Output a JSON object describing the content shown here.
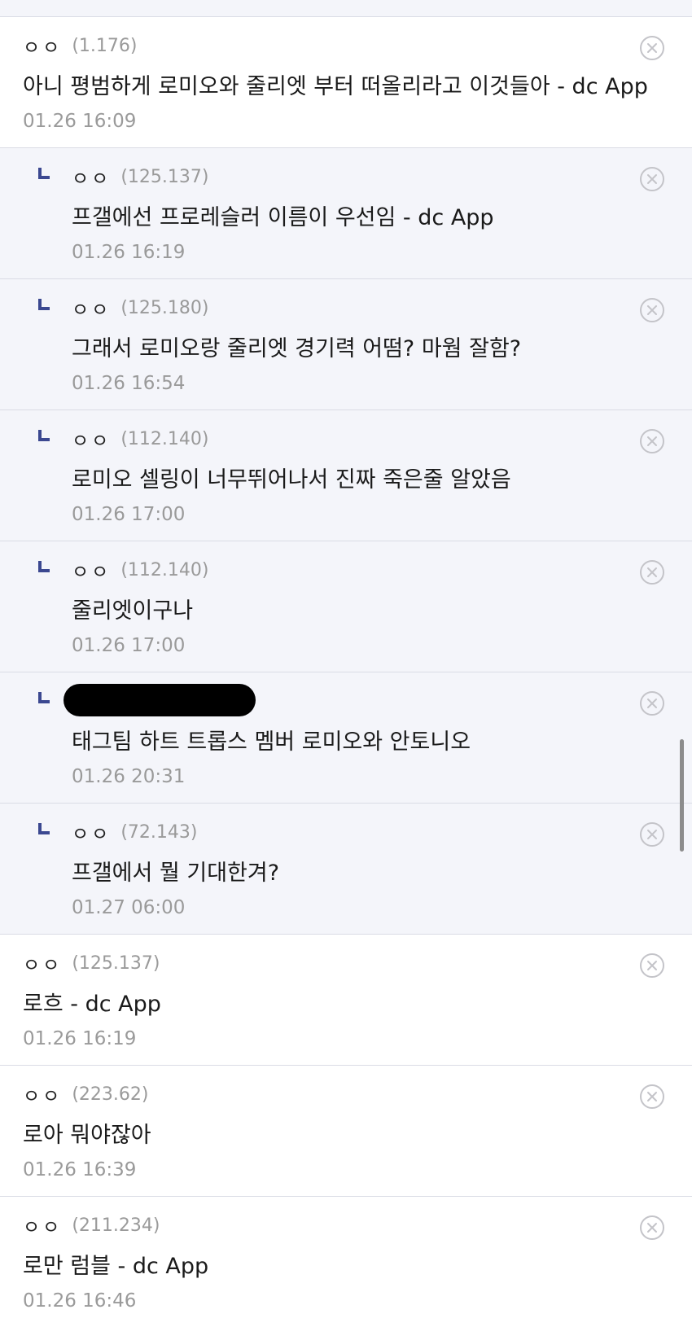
{
  "comments": [
    {
      "reply": false,
      "author": "ㅇㅇ",
      "ip": "(1.176)",
      "text": "아니 평범하게 로미오와 줄리엣 부터 떠올리라고 이것들아 - dc App",
      "time": "01.26 16:09",
      "redacted": false
    },
    {
      "reply": true,
      "author": "ㅇㅇ",
      "ip": "(125.137)",
      "text": "프갤에선 프로레슬러 이름이 우선임 - dc App",
      "time": "01.26 16:19",
      "redacted": false
    },
    {
      "reply": true,
      "author": "ㅇㅇ",
      "ip": "(125.180)",
      "text": "그래서 로미오랑 줄리엣 경기력 어떰? 마웜 잘함?",
      "time": "01.26 16:54",
      "redacted": false
    },
    {
      "reply": true,
      "author": "ㅇㅇ",
      "ip": "(112.140)",
      "text": "로미오 셀링이 너무뛰어나서 진짜 죽은줄 알았음",
      "time": "01.26 17:00",
      "redacted": false
    },
    {
      "reply": true,
      "author": "ㅇㅇ",
      "ip": "(112.140)",
      "text": "줄리엣이구나",
      "time": "01.26 17:00",
      "redacted": false
    },
    {
      "reply": true,
      "author": "",
      "ip": "",
      "text": "태그팀 하트 트롭스 멤버 로미오와 안토니오",
      "time": "01.26 20:31",
      "redacted": true
    },
    {
      "reply": true,
      "author": "ㅇㅇ",
      "ip": "(72.143)",
      "text": "프갤에서 뭘 기대한겨?",
      "time": "01.27 06:00",
      "redacted": false
    },
    {
      "reply": false,
      "author": "ㅇㅇ",
      "ip": "(125.137)",
      "text": "로흐 - dc App",
      "time": "01.26 16:19",
      "redacted": false
    },
    {
      "reply": false,
      "author": "ㅇㅇ",
      "ip": "(223.62)",
      "text": "로아 뭐야잖아",
      "time": "01.26 16:39",
      "redacted": false
    },
    {
      "reply": false,
      "author": "ㅇㅇ",
      "ip": "(211.234)",
      "text": "로만 럼블 - dc App",
      "time": "01.26 16:46",
      "redacted": false
    }
  ],
  "icons": {
    "delete": "close-circle-icon",
    "reply": "reply-arrow-icon"
  },
  "colors": {
    "reply_background": "#f4f5fa",
    "reply_mark": "#3b4890",
    "meta_text": "#9a9a9a",
    "divider": "#dadce5"
  }
}
